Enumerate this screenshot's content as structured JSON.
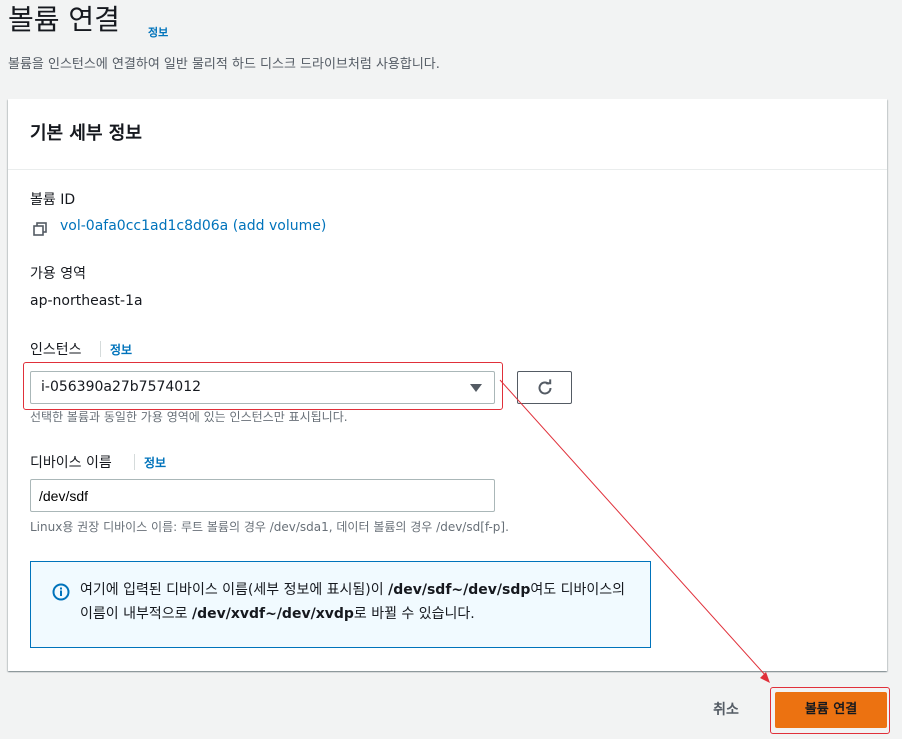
{
  "page": {
    "title": "볼륨 연결",
    "title_info": "정보",
    "subtitle": "볼륨을 인스턴스에 연결하여 일반 물리적 하드 디스크 드라이브처럼 사용합니다."
  },
  "panel": {
    "title": "기본 세부 정보",
    "volume_id_label": "볼륨 ID",
    "volume_id_value": "vol-0afa0cc1ad1c8d06a (add volume)",
    "az_label": "가용 영역",
    "az_value": "ap-northeast-1a",
    "instance_label": "인스턴스",
    "instance_info": "정보",
    "instance_value": "i-056390a27b7574012",
    "instance_desc": "선택한 볼륨과 동일한 가용 영역에 있는 인스턴스만 표시됩니다.",
    "device_label": "디바이스 이름",
    "device_info": "정보",
    "device_value": "/dev/sdf",
    "device_desc": "Linux용 권장 디바이스 이름: 루트 볼륨의 경우 /dev/sda1, 데이터 볼륨의 경우 /dev/sd[f-p]."
  },
  "alert": {
    "part1": "여기에 입력된 디바이스 이름(세부 정보에 표시됨)이 ",
    "bold1": "/dev/sdf~/dev/sdp",
    "part2": "여도 디바이스의 이름이 내부적으로 ",
    "bold2": "/dev/xvdf~/dev/xvdp",
    "part3": "로 바뀔 수 있습니다."
  },
  "actions": {
    "cancel_label": "취소",
    "submit_label": "볼륨 연결"
  },
  "colors": {
    "accent_orange": "#ec7211",
    "link_blue": "#0073bb",
    "annotation_red": "#e0303a"
  }
}
